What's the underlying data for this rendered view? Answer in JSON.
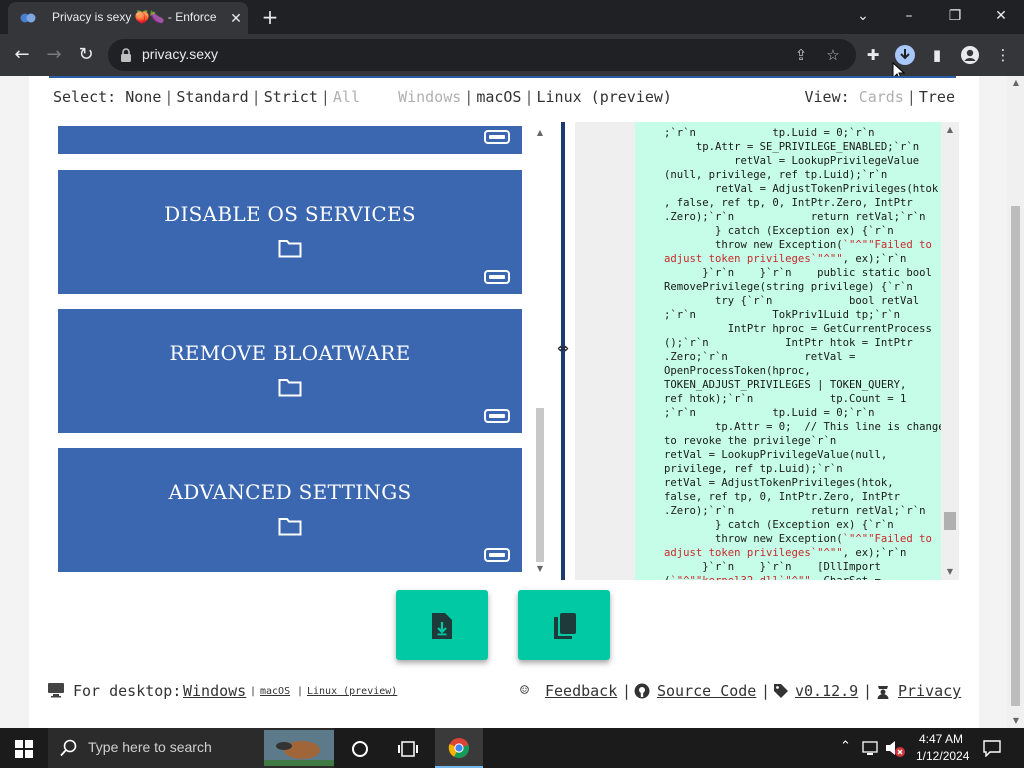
{
  "browser": {
    "tab_title": "Privacy is sexy 🍑🍆 - Enforce privacy",
    "url": "privacy.sexy"
  },
  "select": {
    "label": "Select:",
    "options": [
      "None",
      "Standard",
      "Strict",
      "All"
    ]
  },
  "os": {
    "options": [
      "Windows",
      "macOS",
      "Linux (preview)"
    ]
  },
  "view": {
    "label": "View:",
    "options": [
      "Cards",
      "Tree"
    ]
  },
  "cards": [
    {
      "title": "DISABLE OS SERVICES"
    },
    {
      "title": "REMOVE BLOATWARE"
    },
    {
      "title": "ADVANCED SETTINGS"
    }
  ],
  "code_lines": [
    ";`r`n            tp.Luid = 0;`r`n",
    "     tp.Attr = SE_PRIVILEGE_ENABLED;`r`n",
    "           retVal = LookupPrivilegeValue",
    "(null, privilege, ref tp.Luid);`r`n",
    "        retVal = AdjustTokenPrivileges(htok",
    ", false, ref tp, 0, IntPtr.Zero, IntPtr",
    ".Zero);`r`n            return retVal;`r`n",
    "        } catch (Exception ex) {`r`n",
    "        throw new Exception(`\"^\"\"Failed to",
    "adjust token privileges`\"^\"\", ex);`r`n",
    "      }`r`n    }`r`n    public static bool",
    "RemovePrivilege(string privilege) {`r`n",
    "        try {`r`n            bool retVal",
    ";`r`n            TokPriv1Luid tp;`r`n",
    "          IntPtr hproc = GetCurrentProcess",
    "();`r`n            IntPtr htok = IntPtr",
    ".Zero;`r`n            retVal =",
    "OpenProcessToken(hproc,",
    "TOKEN_ADJUST_PRIVILEGES | TOKEN_QUERY,",
    "ref htok);`r`n            tp.Count = 1",
    ";`r`n            tp.Luid = 0;`r`n",
    "        tp.Attr = 0;  // This line is changed",
    "to revoke the privilege`r`n",
    "retVal = LookupPrivilegeValue(null,",
    "privilege, ref tp.Luid);`r`n",
    "retVal = AdjustTokenPrivileges(htok,",
    "false, ref tp, 0, IntPtr.Zero, IntPtr",
    ".Zero);`r`n            return retVal;`r`n",
    "        } catch (Exception ex) {`r`n",
    "        throw new Exception(`\"^\"\"Failed to",
    "adjust token privileges`\"^\"\", ex);`r`n",
    "      }`r`n    }`r`n    [DllImport",
    "(`\"^\"\"kernel32.dll`\"^\"\", CharSet ="
  ],
  "footer": {
    "desktop_label": "For desktop:",
    "desktop_windows": "Windows",
    "desktop_macos": "macOS",
    "desktop_linux": "Linux (preview)",
    "feedback": "Feedback",
    "source_code": "Source Code",
    "version": "v0.12.9",
    "privacy": "Privacy"
  },
  "taskbar": {
    "search_placeholder": "Type here to search",
    "time": "4:47 AM",
    "date": "1/12/2024"
  },
  "colors": {
    "accent": "#3a67b0",
    "action": "#00c9a4",
    "code_bg": "#c5fde8"
  }
}
